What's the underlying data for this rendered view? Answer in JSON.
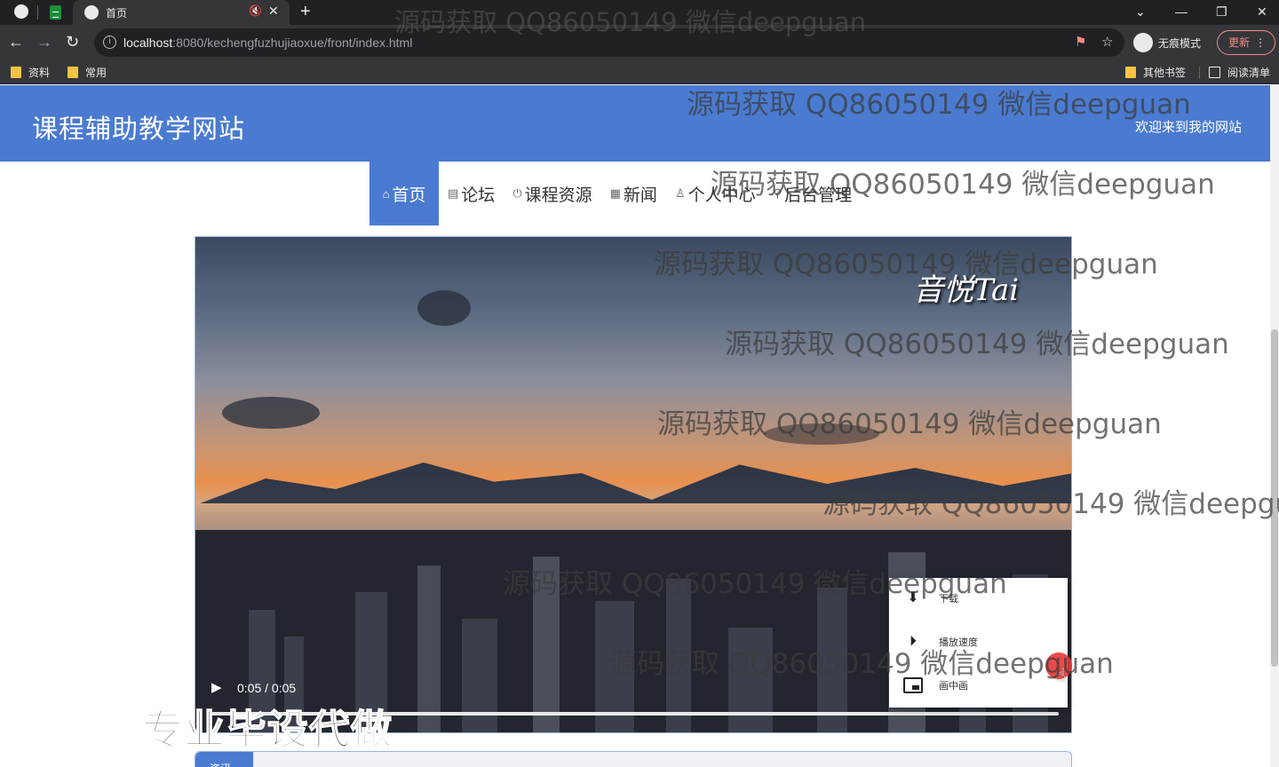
{
  "browser": {
    "tab_title": "首页",
    "tab_mute_icon": "🔇",
    "tab_close": "✕",
    "new_tab": "+",
    "window_controls": [
      "⌄",
      "—",
      "❐",
      "✕"
    ],
    "address": {
      "host": "localhost",
      "rest": ":8080/kechengfuzhujiaoxue/front/index.html"
    },
    "incognito_label": "无痕模式",
    "update_label": "更新",
    "menu_dots": "⋮",
    "bookmarks": [
      "资料",
      "常用"
    ],
    "bookmarks_right": [
      "其他书签",
      "阅读清单"
    ]
  },
  "site": {
    "title": "课程辅助教学网站",
    "welcome": "欢迎来到我的网站"
  },
  "nav": [
    {
      "icon": "⌂",
      "label": "首页"
    },
    {
      "icon": "▤",
      "label": "论坛"
    },
    {
      "icon": "⏻",
      "label": "课程资源"
    },
    {
      "icon": "▦",
      "label": "新闻"
    },
    {
      "icon": "♙",
      "label": "个人中心"
    },
    {
      "icon": "⚲",
      "label": "后台管理"
    }
  ],
  "video": {
    "overlay_text": "音悦Tai",
    "play_icon": "▶",
    "time": "0:05 / 0:05",
    "context_menu": [
      {
        "icon": "⬇",
        "label": "下载"
      },
      {
        "icon": "⏵",
        "label": "播放速度"
      },
      {
        "icon": "pip",
        "label": "画中画"
      }
    ]
  },
  "bottom_tab": "资讯",
  "watermark": "源码获取 QQ86050149 微信deepguan",
  "promo_text": "专业毕设代做",
  "colors": {
    "brand_blue": "#4a7bd1",
    "chrome_dark": "#202124"
  }
}
